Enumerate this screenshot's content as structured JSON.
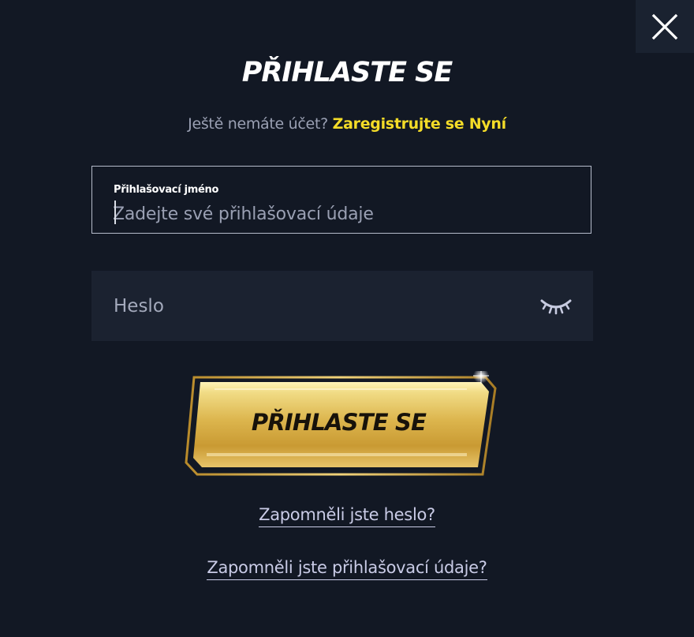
{
  "modal": {
    "close_icon": "close-icon",
    "title": "PŘIHLASTE SE",
    "register": {
      "prompt": "Ještě nemáte účet?",
      "link": "Zaregistrujte se Nyní"
    },
    "username": {
      "label": "Přihlašovací jméno",
      "value": "",
      "placeholder": "Zadejte své přihlašovací údaje"
    },
    "password": {
      "value": "",
      "placeholder": "Heslo",
      "toggle_icon": "eye-closed-icon"
    },
    "login_button": "PŘIHLASTE SE",
    "forgot_password": "Zapomněli jste heslo?",
    "forgot_username": "Zapomněli jste přihlašovací údaje?"
  },
  "colors": {
    "background": "#121824",
    "field_background": "#1b2230",
    "accent_yellow": "#f4dc28",
    "button_gold": "#e5c45a",
    "muted_text": "#9aa0b3"
  }
}
